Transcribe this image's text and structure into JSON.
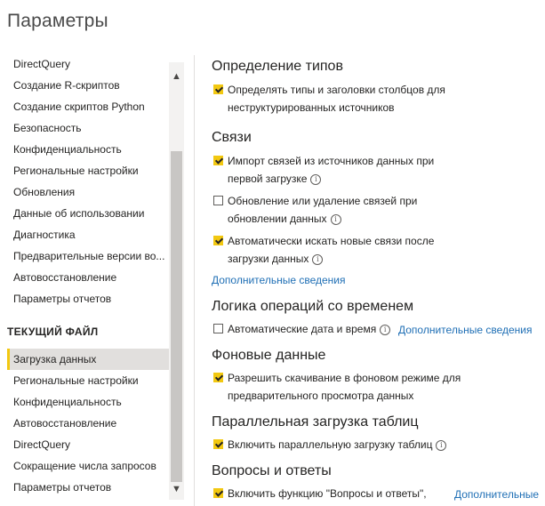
{
  "title": "Параметры",
  "sidebar": {
    "global_items": [
      {
        "label": "DirectQuery"
      },
      {
        "label": "Создание R-скриптов"
      },
      {
        "label": "Создание скриптов Python"
      },
      {
        "label": "Безопасность"
      },
      {
        "label": "Конфиденциальность"
      },
      {
        "label": "Региональные настройки"
      },
      {
        "label": "Обновления"
      },
      {
        "label": "Данные об использовании"
      },
      {
        "label": "Диагностика"
      },
      {
        "label": "Предварительные версии во..."
      },
      {
        "label": "Автовосстановление"
      },
      {
        "label": "Параметры отчетов"
      }
    ],
    "section_heading": "ТЕКУЩИЙ ФАЙЛ",
    "file_items": [
      {
        "label": "Загрузка данных",
        "selected": true
      },
      {
        "label": "Региональные настройки"
      },
      {
        "label": "Конфиденциальность"
      },
      {
        "label": "Автовосстановление"
      },
      {
        "label": "DirectQuery"
      },
      {
        "label": "Сокращение числа запросов"
      },
      {
        "label": "Параметры отчетов"
      }
    ],
    "scroll_up_icon": "chevron-up-icon",
    "scroll_down_icon": "chevron-down-icon"
  },
  "main": {
    "type_detection": {
      "heading": "Определение типов",
      "option1_line1": "Определять типы и заголовки столбцов для",
      "option1_line2": "неструктурированных источников",
      "option1_checked": true
    },
    "relationships": {
      "heading": "Связи",
      "option1_line1": "Импорт связей из источников данных при",
      "option1_line2": "первой загрузке",
      "option1_checked": true,
      "option2_line1": "Обновление или удаление связей при",
      "option2_line2": "обновлении данных",
      "option2_checked": false,
      "option3_line1": "Автоматически искать новые связи после",
      "option3_line2": "загрузки данных",
      "option3_checked": true,
      "more_link": "Дополнительные сведения"
    },
    "time_intelligence": {
      "heading": "Логика операций со временем",
      "option1": "Автоматические дата и время",
      "option1_checked": false,
      "more_link": "Дополнительные сведения"
    },
    "background_data": {
      "heading": "Фоновые данные",
      "option1_line1": "Разрешить скачивание в фоновом режиме для",
      "option1_line2": "предварительного просмотра данных",
      "option1_checked": true
    },
    "parallel_loading": {
      "heading": "Параллельная загрузка таблиц",
      "option1": "Включить параллельную загрузку таблиц",
      "option1_checked": true
    },
    "qna": {
      "heading": "Вопросы и ответы",
      "option1": "Включить функцию \"Вопросы и ответы\",",
      "option1_checked": true,
      "more_link": "Дополнительные"
    }
  },
  "colors": {
    "accent": "#f2c811",
    "link": "#1f6fb5",
    "selected_bg": "#e1dfdd"
  }
}
